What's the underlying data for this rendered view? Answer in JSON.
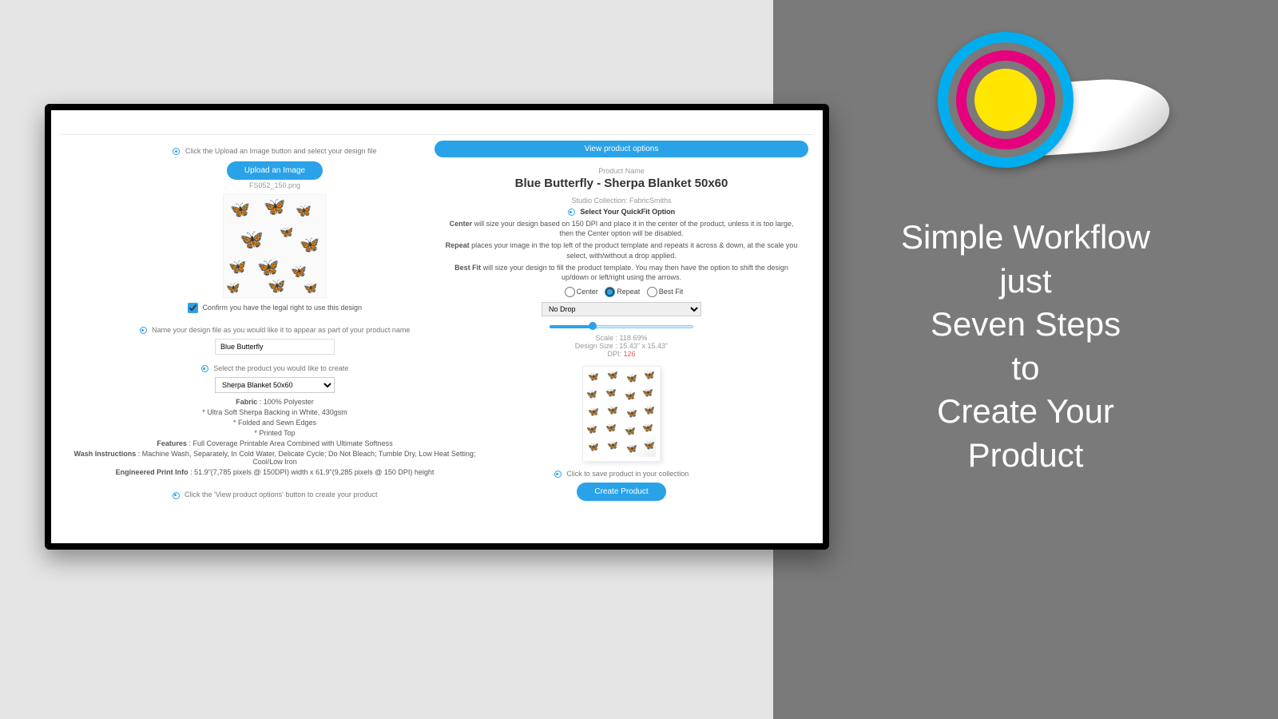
{
  "promo": {
    "line1": "Simple Workflow",
    "line2": "just",
    "line3": "Seven Steps",
    "line4": "to",
    "line5": "Create Your",
    "line6": "Product"
  },
  "left": {
    "step1": "Click the Upload an Image button and select your design file",
    "upload_btn": "Upload an Image",
    "filename": "FS052_150.png",
    "confirm_label": "Confirm you have the legal right to use this design",
    "step2": "Name your design file as you would like it to appear as part of your product name",
    "design_name_value": "Blue Butterfly",
    "step3": "Select the product you would like to create",
    "product_select_value": "Sherpa Blanket 50x60",
    "fabric_label": "Fabric",
    "fabric_value": "100% Polyester",
    "bullet1": "* Ultra Soft Sherpa Backing in White, 430gsm",
    "bullet2": "* Folded and Sewn Edges",
    "bullet3": "* Printed Top",
    "features_label": "Features",
    "features_value": "Full Coverage Printable Area Combined with Ultimate Softness",
    "wash_label": "Wash Instructions",
    "wash_value": "Machine Wash, Separately, In Cold Water, Delicate Cycle; Do Not Bleach; Tumble Dry, Low Heat Setting; Cool/Low Iron",
    "print_label": "Engineered Print Info",
    "print_value": "51.9\"(7,785 pixels @ 150DPI) width x 61.9\"(9,285 pixels @ 150 DPI) height",
    "step4": "Click the 'View product options' button to create your product"
  },
  "right": {
    "view_btn": "View product options",
    "prodname_label": "Product Name",
    "prodname": "Blue Butterfly - Sherpa Blanket 50x60",
    "studio": "Studio Collection: FabricSmiths",
    "quickfit_step": "Select Your QuickFit Option",
    "center_desc": "will size your design based on 150 DPI and place it in the center of the product, unless it is too large, then the Center option will be disabled.",
    "repeat_desc": "places your image in the top left of the product template and repeats it across & down, at the scale you select, with/without a drop applied.",
    "bestfit_desc": "will size your design to fill the product template. You may then have the option to shift the design up/down or left/right using the arrows.",
    "radio_center": "Center",
    "radio_repeat": "Repeat",
    "radio_bestfit": "Best Fit",
    "drop_value": "No Drop",
    "scale_label": "Scale : 118.69%",
    "designsize_label": "Design Size : 15.43\" x 15.43\"",
    "dpi_label": "DPI:",
    "dpi_value": "126",
    "save_step": "Click to save product in your collection",
    "create_btn": "Create Product",
    "slider_percent": 30,
    "center_b": "Center",
    "repeat_b": "Repeat",
    "bestfit_b": "Best Fit"
  }
}
